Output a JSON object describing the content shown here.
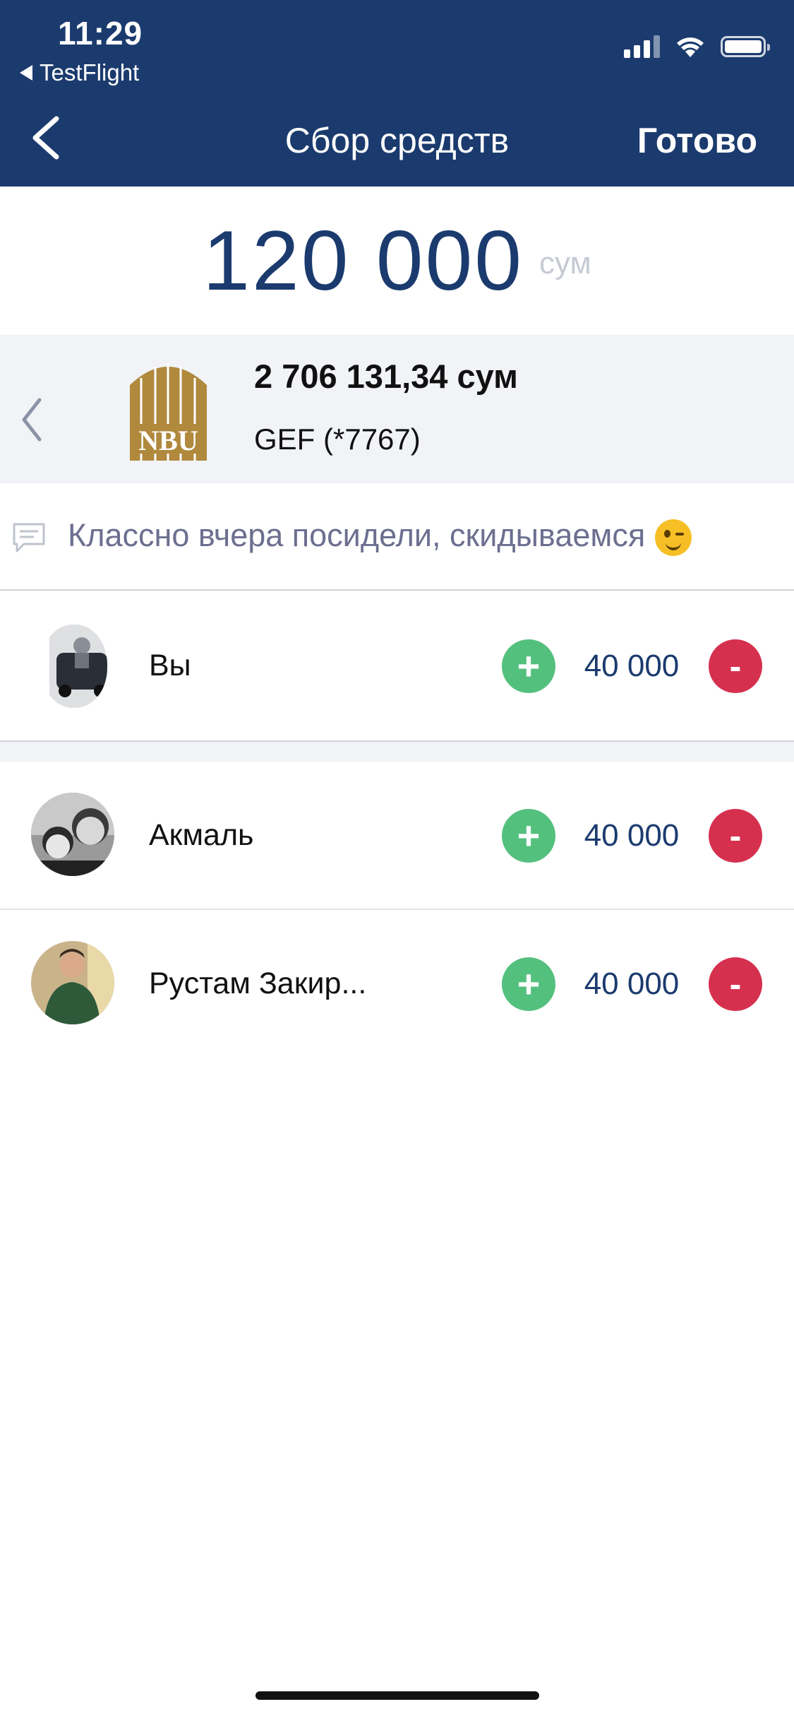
{
  "status_bar": {
    "time": "11:29",
    "back_app": "TestFlight"
  },
  "nav": {
    "title": "Сбор средств",
    "done_label": "Готово"
  },
  "amount": {
    "value": "120 000",
    "currency": "сум"
  },
  "card": {
    "bank_logo_text": "NBU",
    "balance": "2 706 131,34 сум",
    "name": "GEF (*7767)"
  },
  "comment": {
    "text": "Классно вчера посидели, скидываемся",
    "emoji": "wink-emoji"
  },
  "members": [
    {
      "name": "Вы",
      "amount": "40 000"
    },
    {
      "name": "Акмаль",
      "amount": "40 000"
    },
    {
      "name": "Рустам Закир...",
      "amount": "40 000"
    }
  ],
  "buttons": {
    "plus": "+",
    "minus": "-"
  },
  "colors": {
    "header": "#1b3b6e",
    "plus": "#54c07e",
    "minus": "#d6304f",
    "amount": "#1b3b6e",
    "bank_gold": "#b0893d"
  }
}
